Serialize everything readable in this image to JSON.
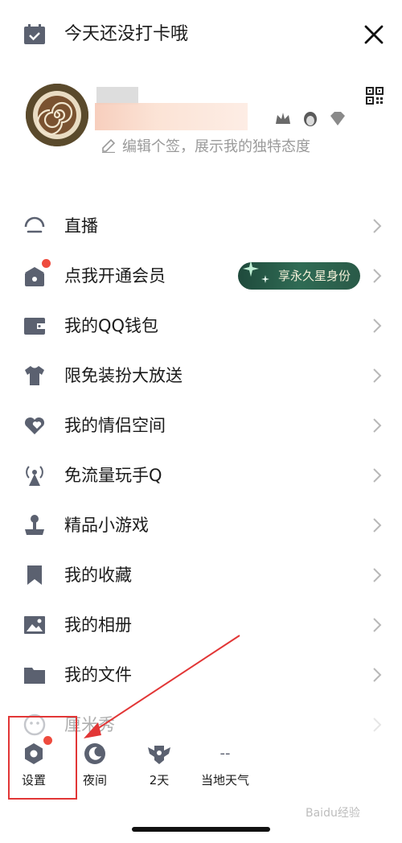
{
  "header": {
    "checkin_text": "今天还没打卡哦"
  },
  "profile": {
    "signature": "编辑个签，展示我的独特态度"
  },
  "menu": {
    "items": [
      {
        "label": "直播"
      },
      {
        "label": "点我开通会员",
        "badge": "享永久星身份"
      },
      {
        "label": "我的QQ钱包"
      },
      {
        "label": "限免装扮大放送"
      },
      {
        "label": "我的情侣空间"
      },
      {
        "label": "免流量玩手Q"
      },
      {
        "label": "精品小游戏"
      },
      {
        "label": "我的收藏"
      },
      {
        "label": "我的相册"
      },
      {
        "label": "我的文件"
      },
      {
        "label": "厘米秀"
      }
    ]
  },
  "bottom": {
    "settings": "设置",
    "night": "夜间",
    "days": "2天",
    "weather_temp": "--",
    "weather": "当地天气"
  },
  "colors": {
    "icon": "#5b6170",
    "red_dot": "#ee4b3e",
    "highlight": "#e23636"
  },
  "watermark": "Baidu经验"
}
